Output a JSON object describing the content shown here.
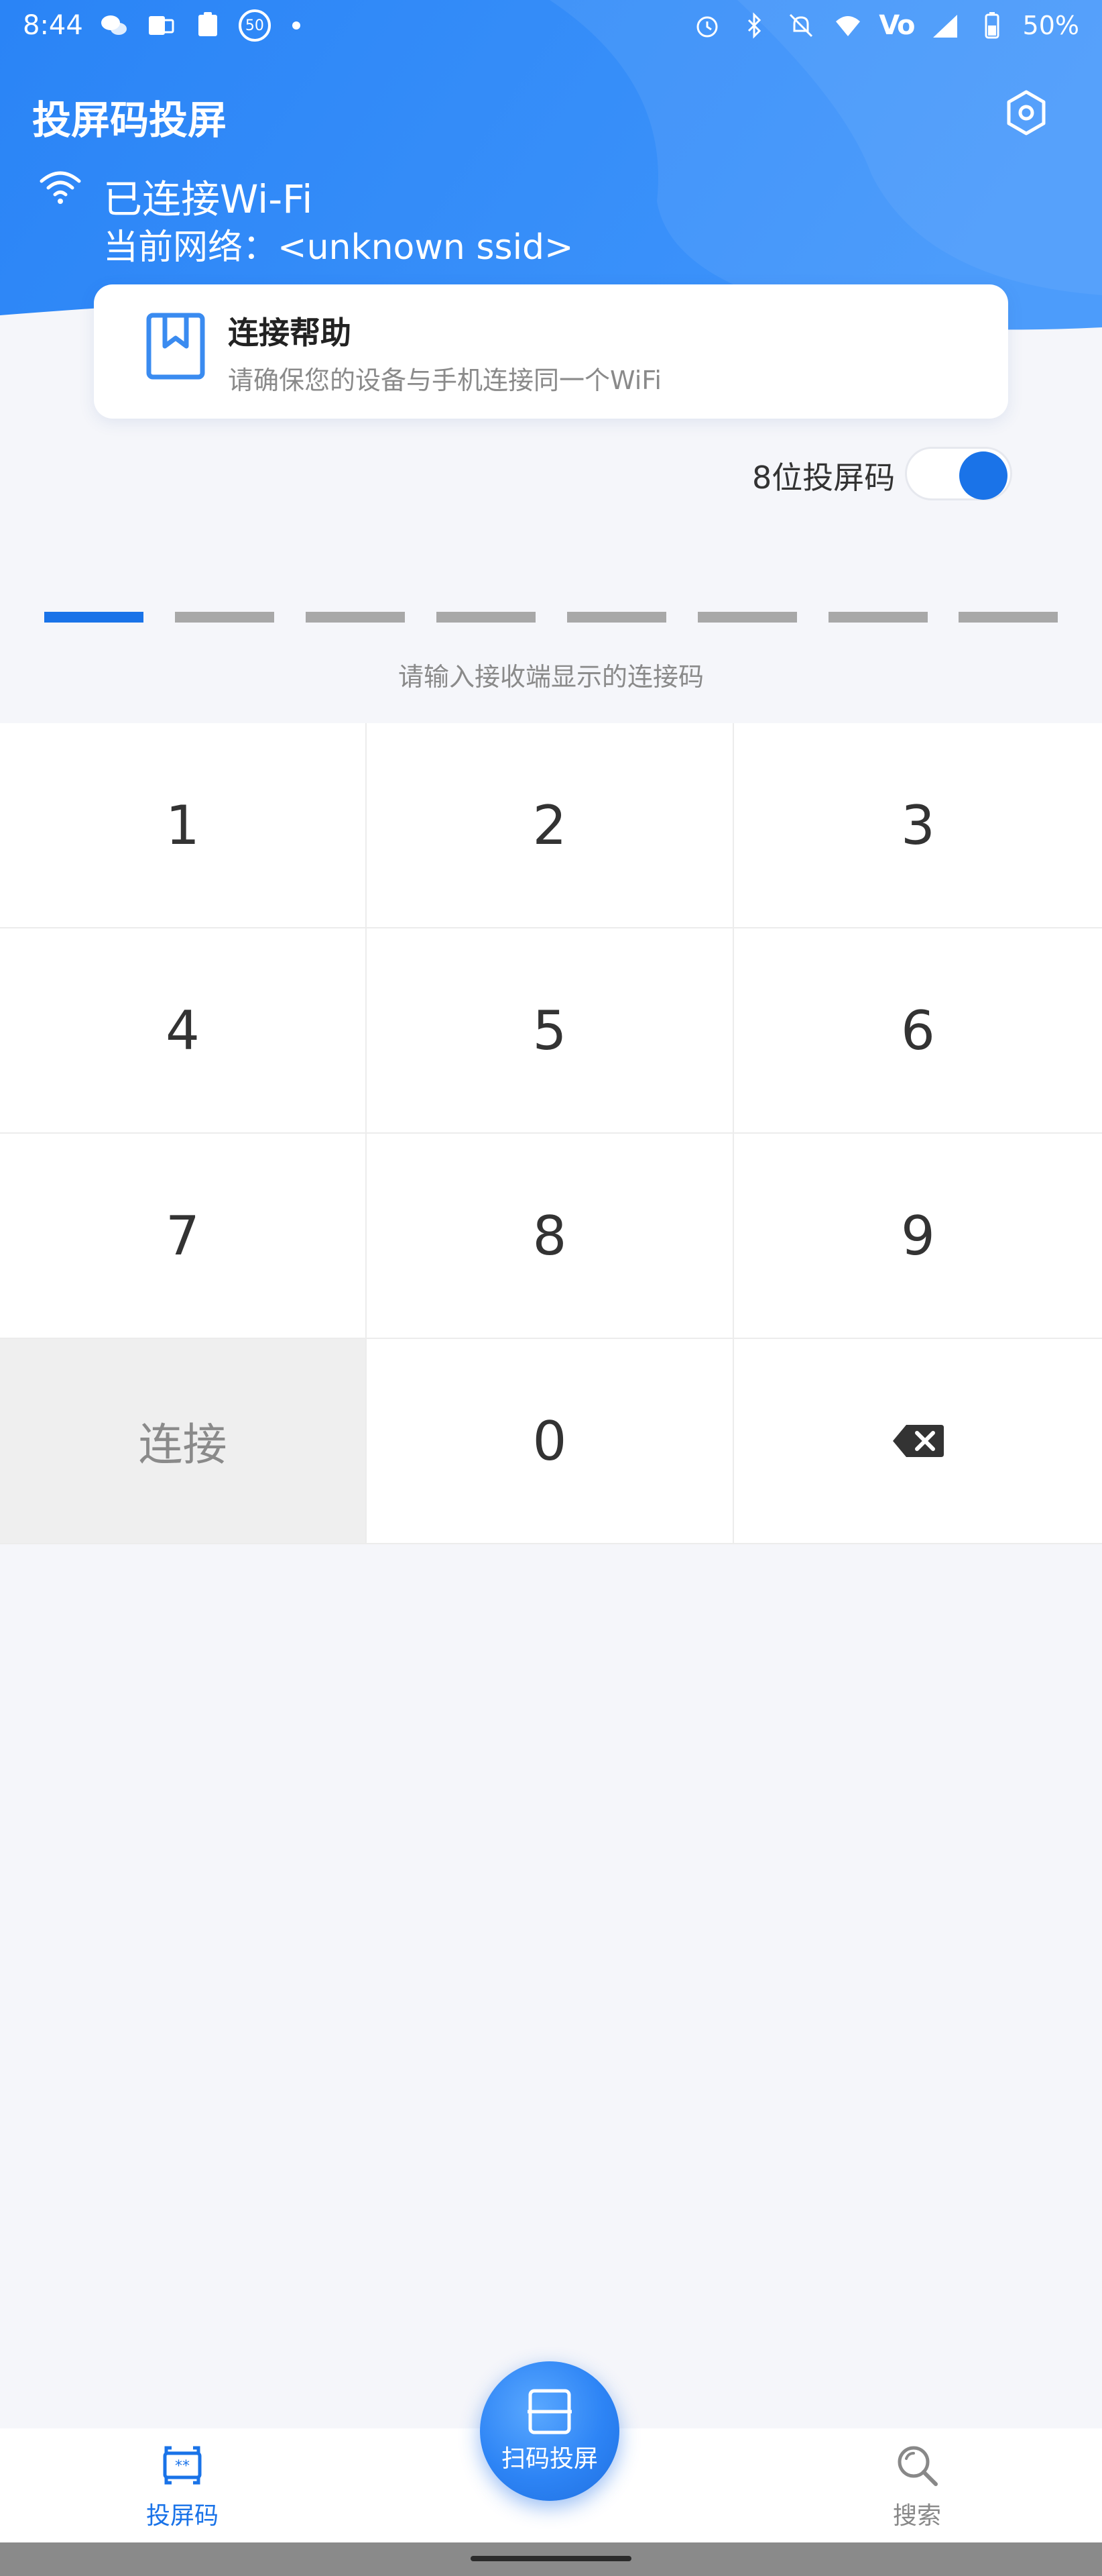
{
  "status_bar": {
    "time": "8:44",
    "battery_text": "50%",
    "network_badge": "50",
    "volte_label": "Vo",
    "icons": [
      "wechat-icon",
      "outlook-icon",
      "clipboard-icon",
      "notification-50-icon",
      "dot-icon",
      "alarm-icon",
      "bluetooth-icon",
      "mute-icon",
      "wifi-icon",
      "volte-icon",
      "signal-icon",
      "battery-icon"
    ]
  },
  "header": {
    "title": "投屏码投屏",
    "settings_icon": "hexagon-settings-icon",
    "wifi_status": "已连接Wi-Fi",
    "network_line": "当前网络：<unknown ssid>"
  },
  "help_card": {
    "icon": "bookmark-book-icon",
    "title": "连接帮助",
    "description": "请确保您的设备与手机连接同一个WiFi"
  },
  "code_mode": {
    "label": "8位投屏码",
    "enabled": true
  },
  "code_entry": {
    "length": 8,
    "active_index": 0,
    "hint": "请输入接收端显示的连接码"
  },
  "keypad": {
    "keys": [
      "1",
      "2",
      "3",
      "4",
      "5",
      "6",
      "7",
      "8",
      "9",
      "连接",
      "0",
      "⌫"
    ]
  },
  "bottom_nav": {
    "left_label": "投屏码",
    "center_label": "扫码投屏",
    "right_label": "搜索"
  },
  "colors": {
    "accent": "#1a73e8",
    "header_gradient_start": "#2a86f7",
    "header_gradient_end": "#3e93fa",
    "background": "#f5f6fa"
  }
}
